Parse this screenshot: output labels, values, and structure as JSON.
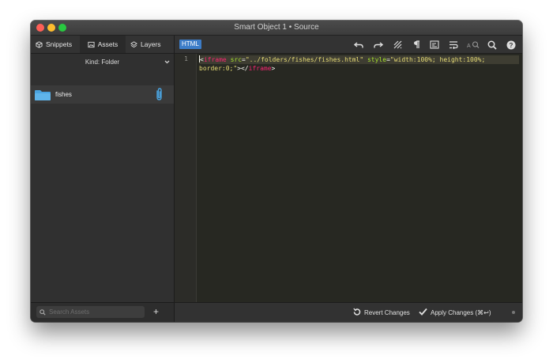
{
  "window": {
    "title": "Smart Object 1 • Source"
  },
  "sidebar": {
    "tabs": [
      {
        "label": "Snippets",
        "icon": "cube-icon"
      },
      {
        "label": "Assets",
        "icon": "image-icon"
      },
      {
        "label": "Layers",
        "icon": "layers-icon"
      }
    ],
    "kind_label": "Kind: Folder",
    "items": [
      {
        "name": "fishes",
        "icon": "folder-icon",
        "badge_icon": "paperclip-icon"
      }
    ],
    "search": {
      "placeholder": "Search Assets",
      "value": ""
    },
    "add_label": "+"
  },
  "editor": {
    "language": "HTML",
    "toolbar_icons": [
      "undo-icon",
      "redo-icon",
      "invisibles-icon",
      "pilcrow-icon",
      "format-icon",
      "wrap-icon",
      "find-replace-icon",
      "search-icon",
      "help-icon"
    ],
    "line_numbers": [
      "1"
    ],
    "code": {
      "line1": {
        "open": "<",
        "tag": "iframe",
        "attr1": "src",
        "eq": "=",
        "val1": "\"../folders/fishes/fishes.html\"",
        "attr2": "style",
        "val2a": "\"width:100%; height:100%;",
        "val2b": "border:0;\"",
        "close1": "></",
        "close2": ">"
      }
    },
    "buttons": {
      "revert": "Revert Changes",
      "apply": "Apply Changes (⌘↩)"
    }
  },
  "colors": {
    "accent": "#3d7dc8",
    "tag": "#f92672",
    "attr": "#a6e22e",
    "string": "#e6db74",
    "editor_bg": "#272822"
  }
}
